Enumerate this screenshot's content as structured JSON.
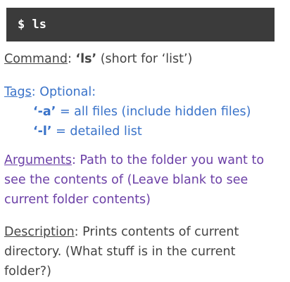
{
  "terminal": {
    "command": "$ ls"
  },
  "command": {
    "label": "Command",
    "sep": ":  ",
    "name": "‘ls’",
    "rest": " (short for ‘list’)"
  },
  "tags": {
    "label": "Tags",
    "rest": ": Optional:",
    "items": [
      {
        "flag": "‘-a’",
        "desc": " = all files (include hidden files)"
      },
      {
        "flag": "‘-l’",
        "desc": " = detailed list"
      }
    ]
  },
  "arguments": {
    "label": "Arguments",
    "lines": [
      ": Path to the folder you want to",
      "see the contents of (Leave blank to see",
      "current folder contents)"
    ]
  },
  "description": {
    "label": "Description",
    "lines": [
      ": Prints contents of current",
      "directory. (What stuff is in the current",
      "folder?)"
    ]
  },
  "colors": {
    "terminal_bg": "#3b3b3b",
    "gray_text": "#444444",
    "blue_text": "#3a73c9",
    "purple_text": "#6b3fa6"
  }
}
